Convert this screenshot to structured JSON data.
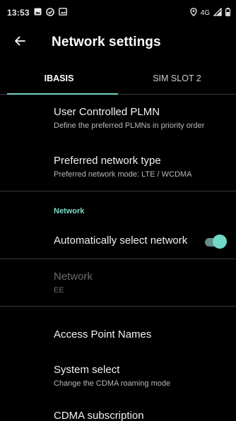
{
  "status_bar": {
    "time": "13:53",
    "network": "4G"
  },
  "app_bar": {
    "title": "Network settings"
  },
  "tabs": [
    {
      "label": "IBASIS",
      "selected": true
    },
    {
      "label": "SIM SLOT 2",
      "selected": false
    }
  ],
  "settings": {
    "user_plmn": {
      "title": "User Controlled PLMN",
      "subtitle": "Define the preferred PLMNs in priority order"
    },
    "preferred_network": {
      "title": "Preferred network type",
      "subtitle": "Preferred network mode: LTE / WCDMA"
    },
    "section_network": "Network",
    "auto_select": {
      "title": "Automatically select network",
      "enabled": true
    },
    "network": {
      "title": "Network",
      "subtitle": "EE",
      "disabled": true
    },
    "apn": {
      "title": "Access Point Names"
    },
    "system_select": {
      "title": "System select",
      "subtitle": "Change the CDMA roaming mode"
    },
    "cdma_subscription": {
      "title": "CDMA subscription"
    }
  },
  "colors": {
    "accent": "#6fd3c7",
    "background": "#000000"
  }
}
